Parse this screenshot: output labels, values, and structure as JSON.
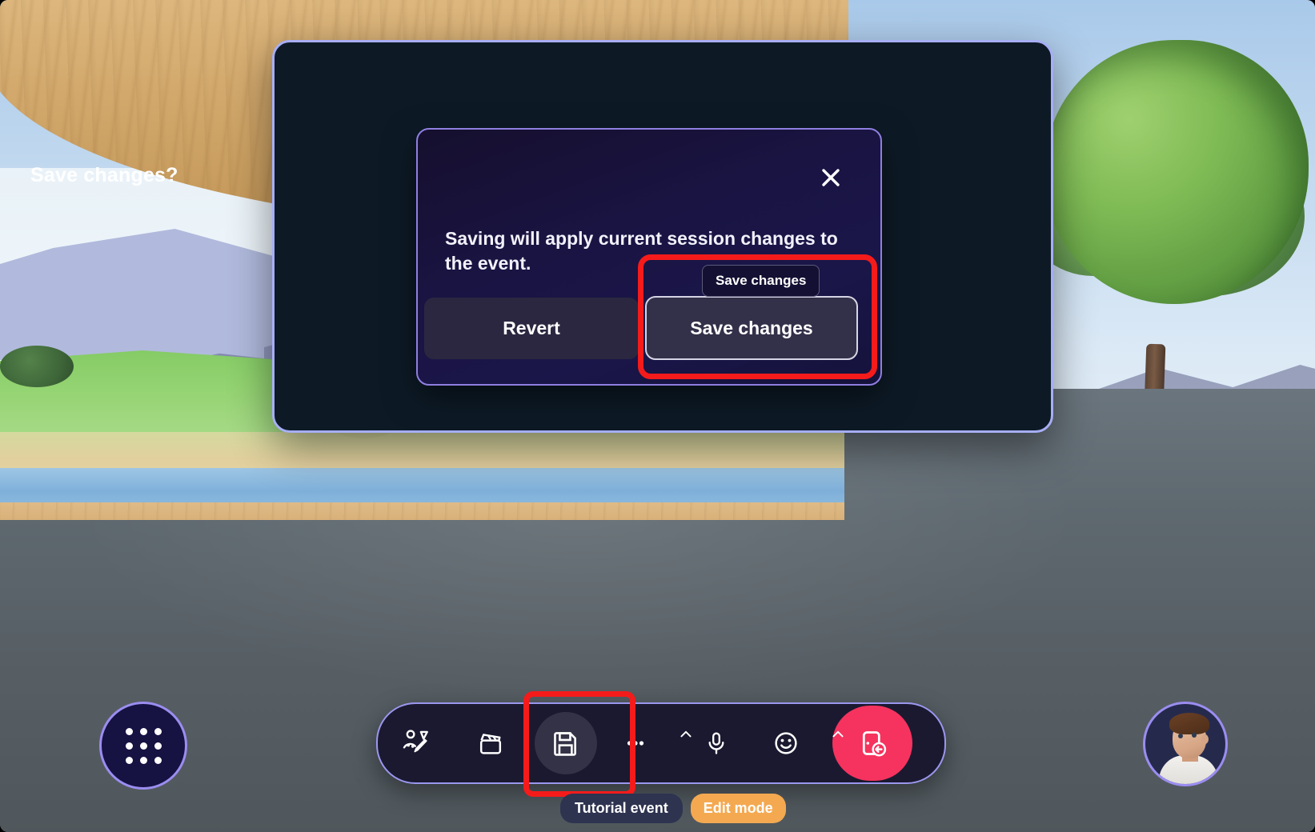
{
  "app": {
    "environment_name": "virtual-lounge-3d-scene"
  },
  "dialog": {
    "title": "Save changes?",
    "body": "Saving will apply current session changes to the event.",
    "close_label": "Close",
    "revert_label": "Revert",
    "save_label": "Save changes",
    "tooltip_label": "Save changes",
    "border_color": "#8f7fe0",
    "highlight_color": "#f51b1b"
  },
  "outer_panel": {
    "border_color": "#a7aef5",
    "background_color": "#0d1a26"
  },
  "apps_button": {
    "icon": "grid-apps-icon",
    "border_color": "#9b8df0"
  },
  "toolbar": {
    "border_color": "#9b97ef",
    "background_color": "#1b1930",
    "items": [
      {
        "name": "avatar-edit",
        "icon": "avatar-pencil-icon",
        "has_caret": false,
        "active": false
      },
      {
        "name": "clapperboard",
        "icon": "clapperboard-icon",
        "has_caret": false,
        "active": false
      },
      {
        "name": "save",
        "icon": "floppy-save-icon",
        "has_caret": false,
        "active": true
      },
      {
        "name": "more",
        "icon": "more-ellipsis-icon",
        "has_caret": true,
        "active": false
      },
      {
        "name": "microphone",
        "icon": "microphone-icon",
        "has_caret": false,
        "active": false
      },
      {
        "name": "reactions",
        "icon": "smiley-face-icon",
        "has_caret": true,
        "active": false
      }
    ],
    "leave": {
      "name": "leave-event",
      "icon": "leave-door-icon",
      "color": "#f5335e"
    }
  },
  "status_chips": {
    "event_label": "Tutorial event",
    "mode_label": "Edit mode",
    "mode_color": "#f4a951",
    "event_color": "#2e3350"
  },
  "avatar": {
    "name": "user-avatar",
    "border_color": "#9b8df0"
  }
}
